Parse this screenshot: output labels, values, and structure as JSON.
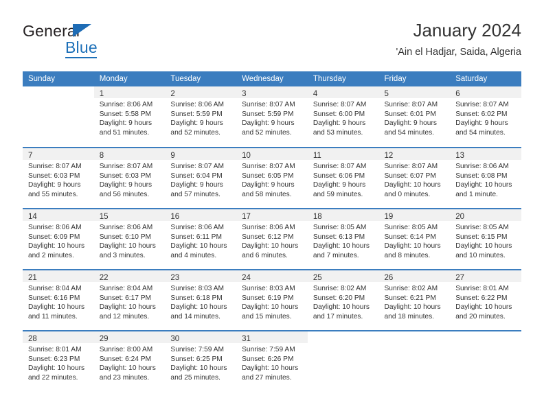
{
  "brand": {
    "name_part1": "General",
    "name_part2": "Blue"
  },
  "header": {
    "title": "January 2024",
    "subtitle": "'Ain el Hadjar, Saida, Algeria"
  },
  "calendar": {
    "weekday_headers": [
      "Sunday",
      "Monday",
      "Tuesday",
      "Wednesday",
      "Thursday",
      "Friday",
      "Saturday"
    ],
    "colors": {
      "header_blue": "#3b7dbf",
      "date_band": "#f1f1f1",
      "text": "#333333",
      "brand_blue": "#1d70b8"
    },
    "weeks": [
      [
        {
          "empty": true
        },
        {
          "day": "1",
          "sunrise": "Sunrise: 8:06 AM",
          "sunset": "Sunset: 5:58 PM",
          "daylight1": "Daylight: 9 hours",
          "daylight2": "and 51 minutes."
        },
        {
          "day": "2",
          "sunrise": "Sunrise: 8:06 AM",
          "sunset": "Sunset: 5:59 PM",
          "daylight1": "Daylight: 9 hours",
          "daylight2": "and 52 minutes."
        },
        {
          "day": "3",
          "sunrise": "Sunrise: 8:07 AM",
          "sunset": "Sunset: 5:59 PM",
          "daylight1": "Daylight: 9 hours",
          "daylight2": "and 52 minutes."
        },
        {
          "day": "4",
          "sunrise": "Sunrise: 8:07 AM",
          "sunset": "Sunset: 6:00 PM",
          "daylight1": "Daylight: 9 hours",
          "daylight2": "and 53 minutes."
        },
        {
          "day": "5",
          "sunrise": "Sunrise: 8:07 AM",
          "sunset": "Sunset: 6:01 PM",
          "daylight1": "Daylight: 9 hours",
          "daylight2": "and 54 minutes."
        },
        {
          "day": "6",
          "sunrise": "Sunrise: 8:07 AM",
          "sunset": "Sunset: 6:02 PM",
          "daylight1": "Daylight: 9 hours",
          "daylight2": "and 54 minutes."
        }
      ],
      [
        {
          "day": "7",
          "sunrise": "Sunrise: 8:07 AM",
          "sunset": "Sunset: 6:03 PM",
          "daylight1": "Daylight: 9 hours",
          "daylight2": "and 55 minutes."
        },
        {
          "day": "8",
          "sunrise": "Sunrise: 8:07 AM",
          "sunset": "Sunset: 6:03 PM",
          "daylight1": "Daylight: 9 hours",
          "daylight2": "and 56 minutes."
        },
        {
          "day": "9",
          "sunrise": "Sunrise: 8:07 AM",
          "sunset": "Sunset: 6:04 PM",
          "daylight1": "Daylight: 9 hours",
          "daylight2": "and 57 minutes."
        },
        {
          "day": "10",
          "sunrise": "Sunrise: 8:07 AM",
          "sunset": "Sunset: 6:05 PM",
          "daylight1": "Daylight: 9 hours",
          "daylight2": "and 58 minutes."
        },
        {
          "day": "11",
          "sunrise": "Sunrise: 8:07 AM",
          "sunset": "Sunset: 6:06 PM",
          "daylight1": "Daylight: 9 hours",
          "daylight2": "and 59 minutes."
        },
        {
          "day": "12",
          "sunrise": "Sunrise: 8:07 AM",
          "sunset": "Sunset: 6:07 PM",
          "daylight1": "Daylight: 10 hours",
          "daylight2": "and 0 minutes."
        },
        {
          "day": "13",
          "sunrise": "Sunrise: 8:06 AM",
          "sunset": "Sunset: 6:08 PM",
          "daylight1": "Daylight: 10 hours",
          "daylight2": "and 1 minute."
        }
      ],
      [
        {
          "day": "14",
          "sunrise": "Sunrise: 8:06 AM",
          "sunset": "Sunset: 6:09 PM",
          "daylight1": "Daylight: 10 hours",
          "daylight2": "and 2 minutes."
        },
        {
          "day": "15",
          "sunrise": "Sunrise: 8:06 AM",
          "sunset": "Sunset: 6:10 PM",
          "daylight1": "Daylight: 10 hours",
          "daylight2": "and 3 minutes."
        },
        {
          "day": "16",
          "sunrise": "Sunrise: 8:06 AM",
          "sunset": "Sunset: 6:11 PM",
          "daylight1": "Daylight: 10 hours",
          "daylight2": "and 4 minutes."
        },
        {
          "day": "17",
          "sunrise": "Sunrise: 8:06 AM",
          "sunset": "Sunset: 6:12 PM",
          "daylight1": "Daylight: 10 hours",
          "daylight2": "and 6 minutes."
        },
        {
          "day": "18",
          "sunrise": "Sunrise: 8:05 AM",
          "sunset": "Sunset: 6:13 PM",
          "daylight1": "Daylight: 10 hours",
          "daylight2": "and 7 minutes."
        },
        {
          "day": "19",
          "sunrise": "Sunrise: 8:05 AM",
          "sunset": "Sunset: 6:14 PM",
          "daylight1": "Daylight: 10 hours",
          "daylight2": "and 8 minutes."
        },
        {
          "day": "20",
          "sunrise": "Sunrise: 8:05 AM",
          "sunset": "Sunset: 6:15 PM",
          "daylight1": "Daylight: 10 hours",
          "daylight2": "and 10 minutes."
        }
      ],
      [
        {
          "day": "21",
          "sunrise": "Sunrise: 8:04 AM",
          "sunset": "Sunset: 6:16 PM",
          "daylight1": "Daylight: 10 hours",
          "daylight2": "and 11 minutes."
        },
        {
          "day": "22",
          "sunrise": "Sunrise: 8:04 AM",
          "sunset": "Sunset: 6:17 PM",
          "daylight1": "Daylight: 10 hours",
          "daylight2": "and 12 minutes."
        },
        {
          "day": "23",
          "sunrise": "Sunrise: 8:03 AM",
          "sunset": "Sunset: 6:18 PM",
          "daylight1": "Daylight: 10 hours",
          "daylight2": "and 14 minutes."
        },
        {
          "day": "24",
          "sunrise": "Sunrise: 8:03 AM",
          "sunset": "Sunset: 6:19 PM",
          "daylight1": "Daylight: 10 hours",
          "daylight2": "and 15 minutes."
        },
        {
          "day": "25",
          "sunrise": "Sunrise: 8:02 AM",
          "sunset": "Sunset: 6:20 PM",
          "daylight1": "Daylight: 10 hours",
          "daylight2": "and 17 minutes."
        },
        {
          "day": "26",
          "sunrise": "Sunrise: 8:02 AM",
          "sunset": "Sunset: 6:21 PM",
          "daylight1": "Daylight: 10 hours",
          "daylight2": "and 18 minutes."
        },
        {
          "day": "27",
          "sunrise": "Sunrise: 8:01 AM",
          "sunset": "Sunset: 6:22 PM",
          "daylight1": "Daylight: 10 hours",
          "daylight2": "and 20 minutes."
        }
      ],
      [
        {
          "day": "28",
          "sunrise": "Sunrise: 8:01 AM",
          "sunset": "Sunset: 6:23 PM",
          "daylight1": "Daylight: 10 hours",
          "daylight2": "and 22 minutes."
        },
        {
          "day": "29",
          "sunrise": "Sunrise: 8:00 AM",
          "sunset": "Sunset: 6:24 PM",
          "daylight1": "Daylight: 10 hours",
          "daylight2": "and 23 minutes."
        },
        {
          "day": "30",
          "sunrise": "Sunrise: 7:59 AM",
          "sunset": "Sunset: 6:25 PM",
          "daylight1": "Daylight: 10 hours",
          "daylight2": "and 25 minutes."
        },
        {
          "day": "31",
          "sunrise": "Sunrise: 7:59 AM",
          "sunset": "Sunset: 6:26 PM",
          "daylight1": "Daylight: 10 hours",
          "daylight2": "and 27 minutes."
        },
        {
          "empty": true
        },
        {
          "empty": true
        },
        {
          "empty": true
        }
      ]
    ]
  }
}
